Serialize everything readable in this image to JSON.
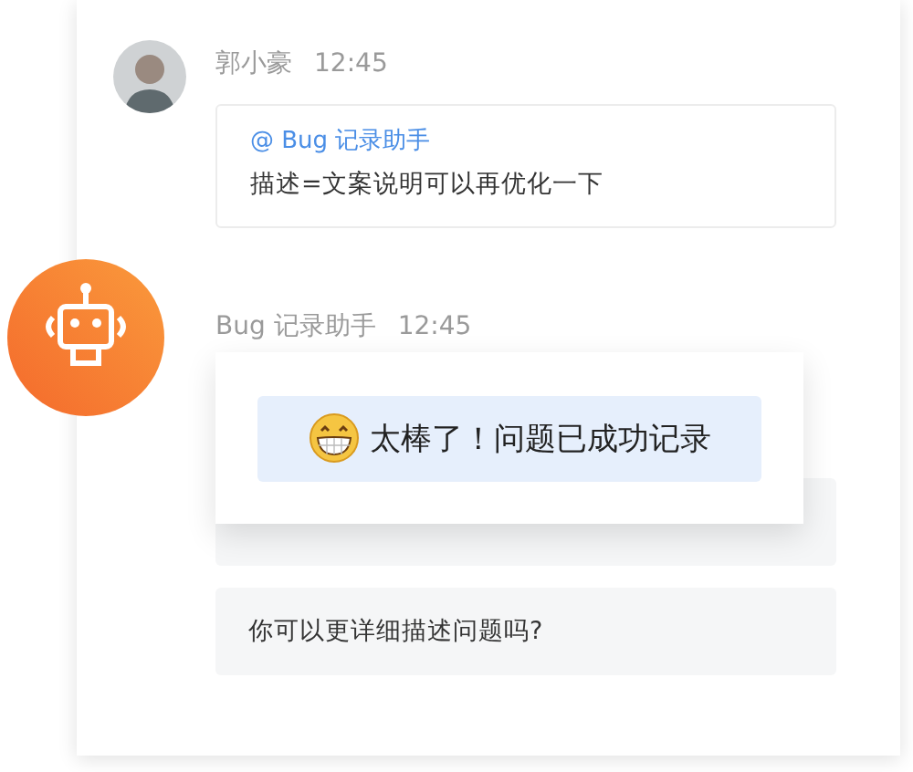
{
  "messages": [
    {
      "kind": "user",
      "sender": "郭小豪",
      "time": "12:45",
      "mention": "@ Bug 记录助手",
      "text": "描述=文案说明可以再优化一下"
    },
    {
      "kind": "bot",
      "sender": "Bug 记录助手",
      "time": "12:45",
      "popup": "太棒了！问题已成功记录",
      "reply": "你可以更详细描述问题吗?"
    }
  ]
}
